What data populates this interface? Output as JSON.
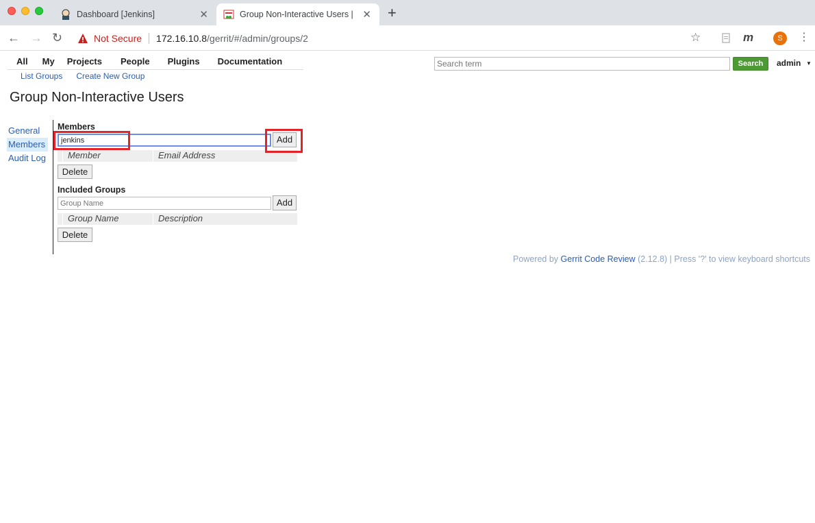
{
  "browser": {
    "tabs": [
      {
        "title": "Dashboard [Jenkins]",
        "active": false
      },
      {
        "title": "Group Non-Interactive Users |",
        "active": true
      }
    ],
    "new_tab": "+",
    "security_label": "Not Secure",
    "url_host": "172.16.10.8",
    "url_path": "/gerrit/#/admin/groups/2",
    "profile_initial": "S",
    "extension_label": "m"
  },
  "topmenu": [
    "All",
    "My",
    "Projects",
    "People",
    "Plugins",
    "Documentation"
  ],
  "submenu": [
    "List Groups",
    "Create New Group"
  ],
  "search": {
    "placeholder": "Search term",
    "button": "Search"
  },
  "user": "admin",
  "page_title": "Group Non-Interactive Users",
  "leftnav": [
    {
      "label": "General",
      "selected": false
    },
    {
      "label": "Members",
      "selected": true
    },
    {
      "label": "Audit Log",
      "selected": false
    }
  ],
  "members": {
    "title": "Members",
    "input_value": "jenkins",
    "add_label": "Add",
    "columns": [
      "Member",
      "Email Address"
    ],
    "delete_label": "Delete"
  },
  "included_groups": {
    "title": "Included Groups",
    "placeholder": "Group Name",
    "add_label": "Add",
    "columns": [
      "Group Name",
      "Description"
    ],
    "delete_label": "Delete"
  },
  "footer": {
    "prefix": "Powered by",
    "link": "Gerrit Code Review",
    "suffix": "(2.12.8) | Press '?' to view keyboard shortcuts"
  },
  "colors": {
    "highlight": "#e3232a",
    "search_button": "#4d9a34",
    "link": "#2a5db0"
  }
}
